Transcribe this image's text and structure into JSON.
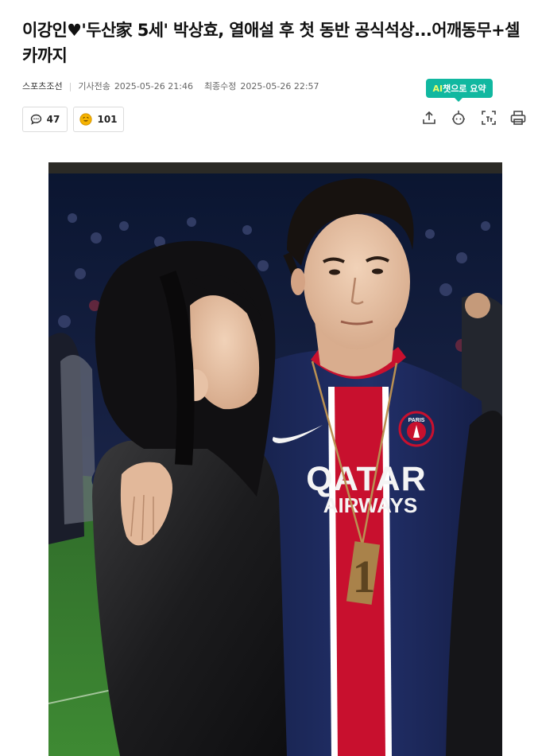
{
  "article": {
    "headline_part1": "이강인",
    "headline_heart": "♥",
    "headline_part2": "'두산家 5세' 박상효, 열애설 후 첫 동반 공식석상...어깨동무+셀카까지",
    "source": "스포츠조선",
    "sent_label": "기사전송",
    "sent_time": "2025-05-26 21:46",
    "updated_label": "최종수정",
    "updated_time": "2025-05-26 22:57"
  },
  "engagement": {
    "comments_count": "47",
    "reactions_count": "101"
  },
  "toolbar": {
    "ai_summary_prefix": "AI",
    "ai_summary_label": "챗으로 요약",
    "icons": [
      "share-icon",
      "ai-chat-icon",
      "font-size-icon",
      "print-icon"
    ]
  },
  "photo": {
    "jersey_sponsor_line1": "QATAR",
    "jersey_sponsor_line2": "AIRWAYS",
    "crest_text": "PARIS",
    "medal_text": "1"
  },
  "colors": {
    "ai_badge": "#11b8a0",
    "jersey_navy": "#1c2a5c",
    "jersey_red": "#c8102e"
  }
}
